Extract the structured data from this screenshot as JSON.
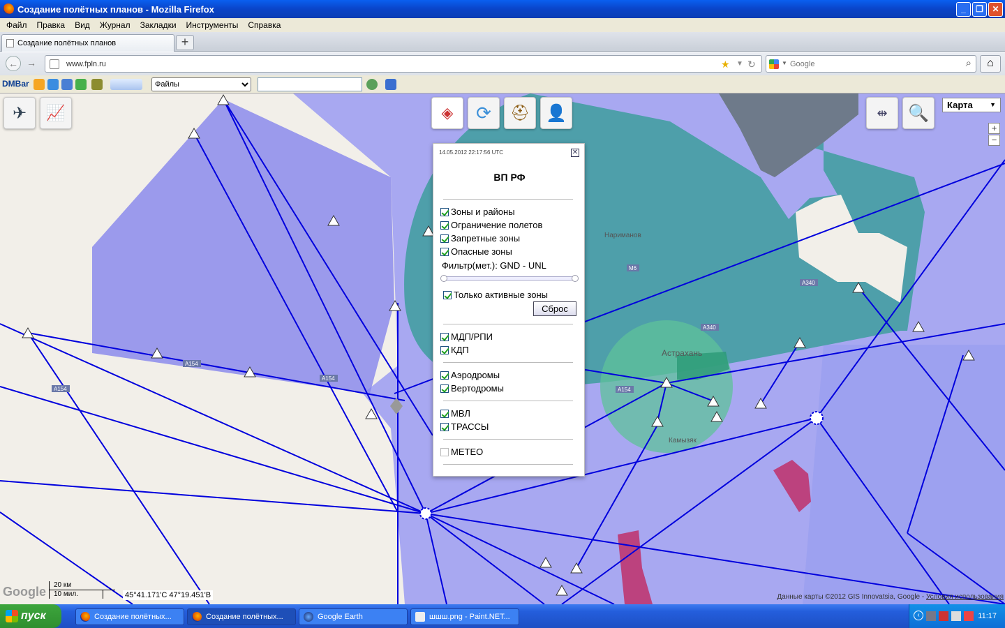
{
  "window": {
    "title": "Создание полётных планов - Mozilla Firefox",
    "controls": [
      "minimize",
      "maximize",
      "close"
    ]
  },
  "menu": [
    "Файл",
    "Правка",
    "Вид",
    "Журнал",
    "Закладки",
    "Инструменты",
    "Справка"
  ],
  "tabs": [
    {
      "label": "Создание полётных планов"
    }
  ],
  "nav": {
    "url": "www.fpln.ru",
    "search_placeholder": "Google"
  },
  "dmbar": {
    "logo": "DMBar",
    "files_label": "Файлы"
  },
  "map": {
    "type_selector": "Карта",
    "zoom_in": "+",
    "zoom_out": "−",
    "scale_km": "20 км",
    "scale_mi": "10 мил.",
    "coords": "45°41.171'С 47°19.451'В",
    "google_logo": "Google",
    "credits_text": "Данные карты ©2012 GIS Innovatsia, Google - ",
    "credits_link": "Условия использования",
    "labels": {
      "narimanov": "Нариманов",
      "astrakhan": "Астрахань",
      "kamyzyak": "Камызяк",
      "road_a154_1": "А154",
      "road_a154_2": "А154",
      "road_a154_3": "А154",
      "road_a154_4": "А154",
      "road_a340_1": "А340",
      "road_a340_2": "А340",
      "road_m6": "М6"
    }
  },
  "panel": {
    "timestamp": "14.05.2012 22:17:56 UTC",
    "title": "ВП РФ",
    "layers": [
      {
        "label": "Зоны и районы",
        "checked": true
      },
      {
        "label": "Ограничение полетов",
        "checked": true
      },
      {
        "label": "Запретные зоны",
        "checked": true
      },
      {
        "label": "Опасные зоны",
        "checked": true
      }
    ],
    "filter_label": "Фильтр(мет.): GND - UNL",
    "active_only": {
      "label": "Только активные зоны",
      "checked": true
    },
    "reset_label": "Сброс",
    "group2": [
      {
        "label": "МДП/РПИ",
        "checked": true
      },
      {
        "label": "КДП",
        "checked": true
      }
    ],
    "group3": [
      {
        "label": "Аэродромы",
        "checked": true
      },
      {
        "label": "Вертодромы",
        "checked": true
      }
    ],
    "group4": [
      {
        "label": "МВЛ",
        "checked": true
      },
      {
        "label": "ТРАССЫ",
        "checked": true
      }
    ],
    "group5": [
      {
        "label": "МЕТЕО",
        "checked": false
      }
    ]
  },
  "taskbar": {
    "start": "пуск",
    "tasks": [
      {
        "label": "Создание полётных..."
      },
      {
        "label": "Создание полётных..."
      },
      {
        "label": "Google Earth"
      },
      {
        "label": "шшш.png - Paint.NET..."
      }
    ],
    "clock": "11:17"
  },
  "colors": {
    "zone_blue": "#8f8ff0",
    "zone_teal": "#3e9e9e",
    "airway": "#0000dd",
    "restricted": "#c0306a"
  }
}
